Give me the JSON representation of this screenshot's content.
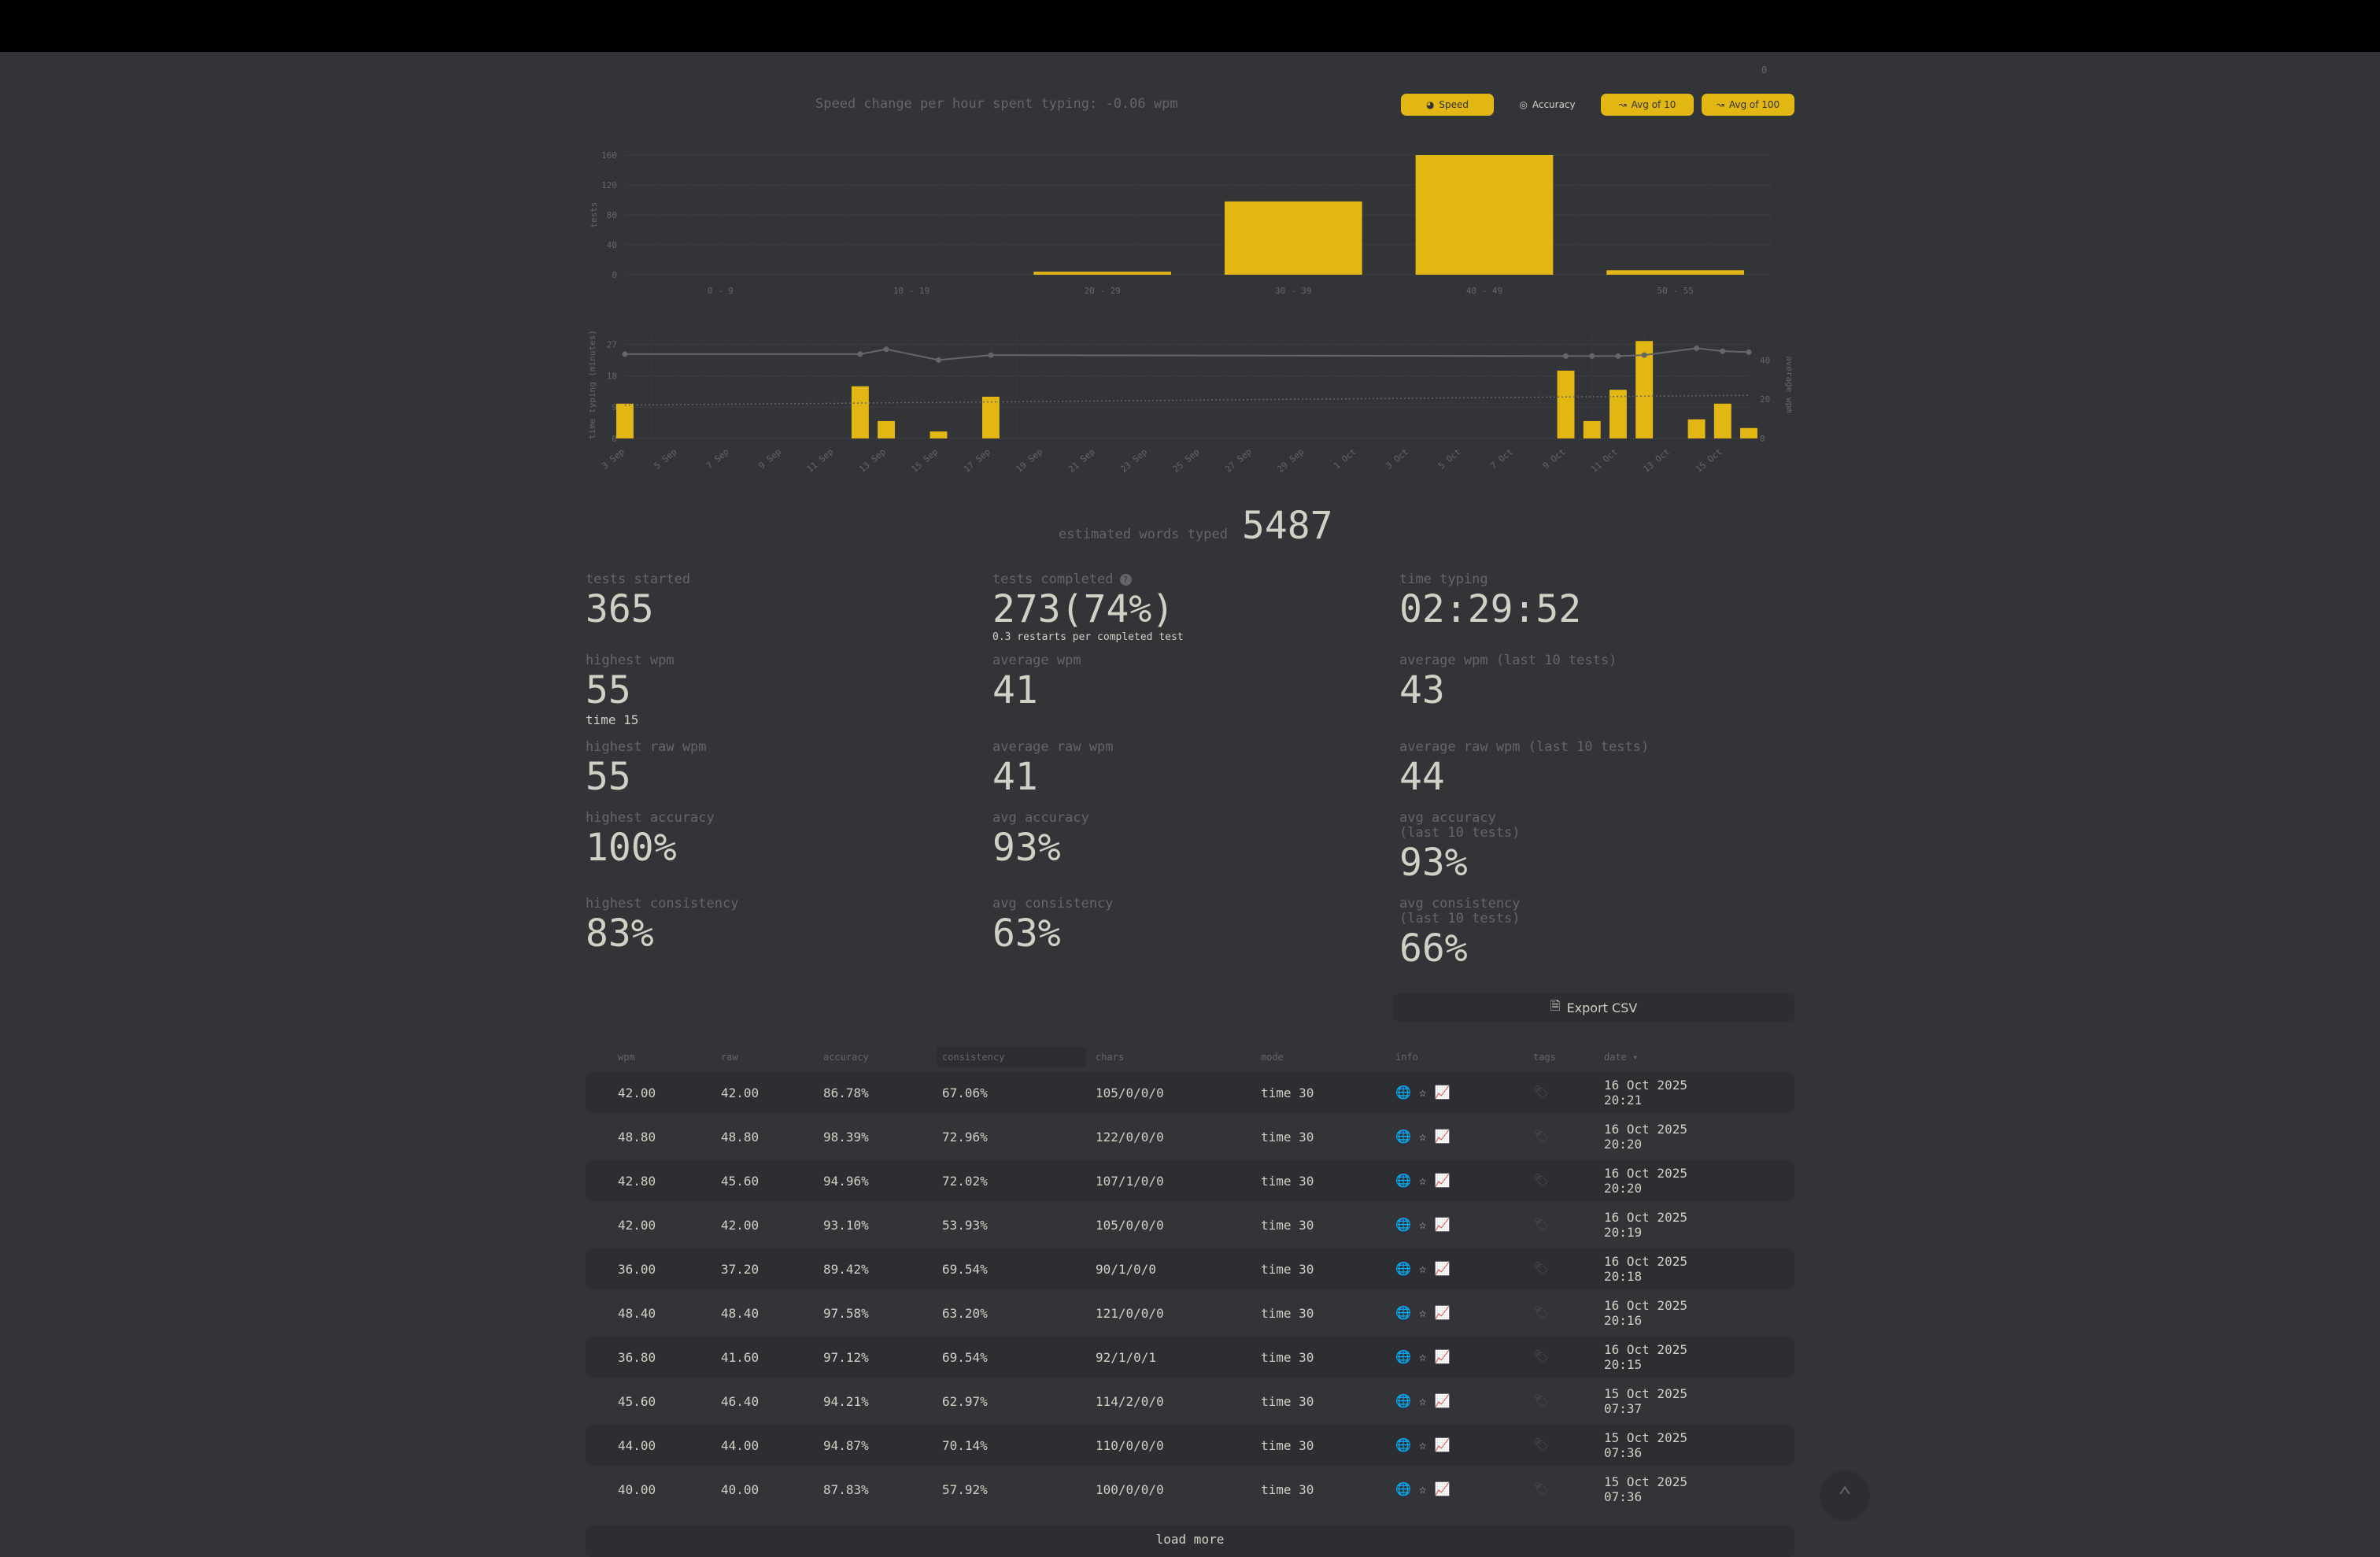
{
  "corner_counter": "0",
  "speed_change": "Speed change per hour spent typing: -0.06 wpm",
  "chart_buttons": {
    "speed": "Speed",
    "accuracy": "Accuracy",
    "avg10": "Avg of 10",
    "avg100": "Avg of 100"
  },
  "chart_data": [
    {
      "type": "bar",
      "ylabel": "tests",
      "categories": [
        "0 - 9",
        "10 - 19",
        "20 - 29",
        "30 - 39",
        "40 - 49",
        "50 - 55"
      ],
      "values": [
        0,
        0,
        4,
        98,
        160,
        6
      ],
      "yticks": [
        0,
        40,
        80,
        120,
        160
      ],
      "ylim": [
        0,
        160
      ],
      "color": "#e2b714",
      "grid": true
    },
    {
      "type": "bar",
      "ylabel": "time typing (minutes)",
      "y2label": "average wpm",
      "x_ticks": [
        "3 Sep",
        "5 Sep",
        "7 Sep",
        "9 Sep",
        "11 Sep",
        "13 Sep",
        "15 Sep",
        "17 Sep",
        "19 Sep",
        "21 Sep",
        "23 Sep",
        "25 Sep",
        "27 Sep",
        "29 Sep",
        "1 Oct",
        "3 Oct",
        "5 Oct",
        "7 Oct",
        "9 Oct",
        "11 Oct",
        "13 Oct",
        "15 Oct"
      ],
      "yticks": [
        0,
        9,
        18,
        27
      ],
      "y2ticks": [
        0,
        20,
        40
      ],
      "ylim": [
        0,
        31
      ],
      "y2lim": [
        0,
        55
      ],
      "series": [
        {
          "kind": "bar",
          "x": [
            "3 Sep",
            "12 Sep",
            "13 Sep",
            "15 Sep",
            "17 Sep",
            "9 Oct",
            "10 Oct",
            "11 Oct",
            "12 Oct",
            "14 Oct",
            "15 Oct",
            "16 Oct"
          ],
          "values": [
            10,
            15,
            5,
            2,
            12,
            19.5,
            5,
            14,
            28,
            5.5,
            10,
            3
          ]
        },
        {
          "kind": "line",
          "x": [
            "3 Sep",
            "12 Sep",
            "13 Sep",
            "15 Sep",
            "17 Sep",
            "9 Oct",
            "10 Oct",
            "11 Oct",
            "12 Oct",
            "14 Oct",
            "15 Oct",
            "16 Oct"
          ],
          "values": [
            43,
            43,
            45.5,
            40,
            42.5,
            42,
            42,
            42,
            42.5,
            46,
            44.5,
            44
          ]
        },
        {
          "kind": "trend",
          "x": [
            "3 Sep",
            "16 Oct"
          ],
          "values": [
            17,
            22
          ]
        }
      ],
      "bar_color": "#e2b714",
      "line_color": "#646669",
      "grid": true
    }
  ],
  "estimated_words": {
    "label": "estimated words typed",
    "value": "5487"
  },
  "stats": {
    "tests_started": {
      "label": "tests started",
      "value": "365"
    },
    "tests_completed": {
      "label": "tests completed",
      "value": "273(74%)",
      "sub": "0.3 restarts per completed test"
    },
    "time_typing": {
      "label": "time typing",
      "value": "02:29:52"
    },
    "highest_wpm": {
      "label": "highest wpm",
      "value": "55",
      "sub": "time 15"
    },
    "average_wpm": {
      "label": "average wpm",
      "value": "41"
    },
    "average_wpm_10": {
      "label": "average wpm (last 10 tests)",
      "value": "43"
    },
    "highest_raw": {
      "label": "highest raw wpm",
      "value": "55"
    },
    "average_raw": {
      "label": "average raw wpm",
      "value": "41"
    },
    "average_raw_10": {
      "label": "average raw wpm (last 10 tests)",
      "value": "44"
    },
    "highest_acc": {
      "label": "highest accuracy",
      "value": "100%"
    },
    "avg_acc": {
      "label": "avg accuracy",
      "value": "93%"
    },
    "avg_acc_10": {
      "label": "avg accuracy\n(last 10 tests)",
      "value": "93%"
    },
    "highest_cons": {
      "label": "highest consistency",
      "value": "83%"
    },
    "avg_cons": {
      "label": "avg consistency",
      "value": "63%"
    },
    "avg_cons_10": {
      "label": "avg consistency\n(last 10 tests)",
      "value": "66%"
    }
  },
  "export_label": "Export CSV",
  "table": {
    "headers": {
      "wpm": "wpm",
      "raw": "raw",
      "accuracy": "accuracy",
      "consistency": "consistency",
      "chars": "chars",
      "mode": "mode",
      "info": "info",
      "tags": "tags",
      "date": "date ▾"
    },
    "rows": [
      {
        "wpm": "42.00",
        "raw": "42.00",
        "accuracy": "86.78%",
        "consistency": "67.06%",
        "chars": "105/0/0/0",
        "mode": "time 30",
        "date1": "16 Oct 2025",
        "date2": "20:21"
      },
      {
        "wpm": "48.80",
        "raw": "48.80",
        "accuracy": "98.39%",
        "consistency": "72.96%",
        "chars": "122/0/0/0",
        "mode": "time 30",
        "date1": "16 Oct 2025",
        "date2": "20:20"
      },
      {
        "wpm": "42.80",
        "raw": "45.60",
        "accuracy": "94.96%",
        "consistency": "72.02%",
        "chars": "107/1/0/0",
        "mode": "time 30",
        "date1": "16 Oct 2025",
        "date2": "20:20"
      },
      {
        "wpm": "42.00",
        "raw": "42.00",
        "accuracy": "93.10%",
        "consistency": "53.93%",
        "chars": "105/0/0/0",
        "mode": "time 30",
        "date1": "16 Oct 2025",
        "date2": "20:19"
      },
      {
        "wpm": "36.00",
        "raw": "37.20",
        "accuracy": "89.42%",
        "consistency": "69.54%",
        "chars": "90/1/0/0",
        "mode": "time 30",
        "date1": "16 Oct 2025",
        "date2": "20:18"
      },
      {
        "wpm": "48.40",
        "raw": "48.40",
        "accuracy": "97.58%",
        "consistency": "63.20%",
        "chars": "121/0/0/0",
        "mode": "time 30",
        "date1": "16 Oct 2025",
        "date2": "20:16"
      },
      {
        "wpm": "36.80",
        "raw": "41.60",
        "accuracy": "97.12%",
        "consistency": "69.54%",
        "chars": "92/1/0/1",
        "mode": "time 30",
        "date1": "16 Oct 2025",
        "date2": "20:15"
      },
      {
        "wpm": "45.60",
        "raw": "46.40",
        "accuracy": "94.21%",
        "consistency": "62.97%",
        "chars": "114/2/0/0",
        "mode": "time 30",
        "date1": "15 Oct 2025",
        "date2": "07:37"
      },
      {
        "wpm": "44.00",
        "raw": "44.00",
        "accuracy": "94.87%",
        "consistency": "70.14%",
        "chars": "110/0/0/0",
        "mode": "time 30",
        "date1": "15 Oct 2025",
        "date2": "07:36"
      },
      {
        "wpm": "40.00",
        "raw": "40.00",
        "accuracy": "87.83%",
        "consistency": "57.92%",
        "chars": "100/0/0/0",
        "mode": "time 30",
        "date1": "15 Oct 2025",
        "date2": "07:36"
      }
    ],
    "info_icons": [
      "globe-icon",
      "star-icon",
      "chart-icon"
    ],
    "tag_icon": "tag-icon"
  },
  "load_more": "load more"
}
